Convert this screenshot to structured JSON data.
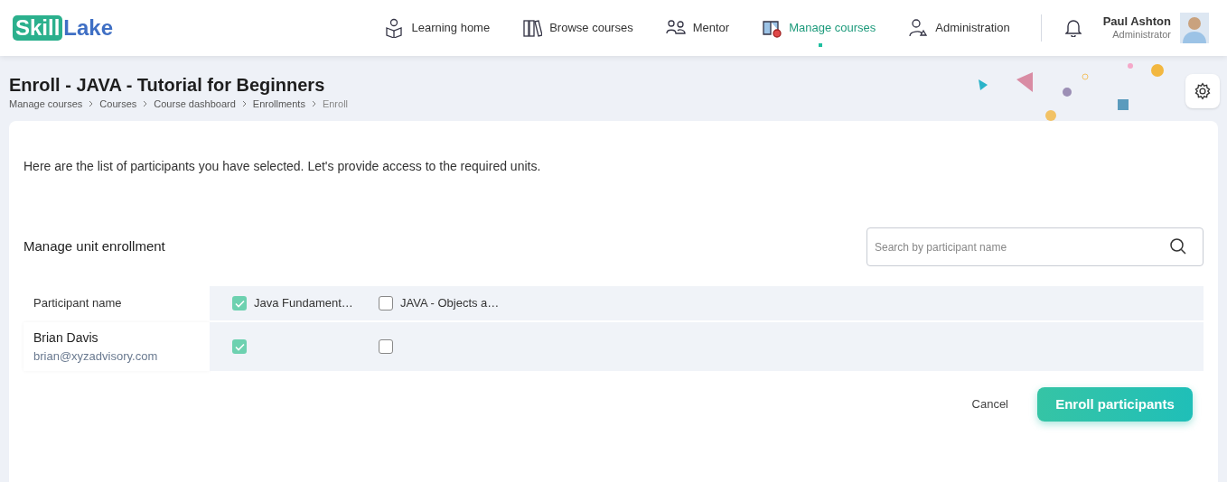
{
  "logo": {
    "part_1": "Skill",
    "part_2": "Lake"
  },
  "nav": [
    {
      "label": "Learning home",
      "selected": false
    },
    {
      "label": "Browse courses",
      "selected": false
    },
    {
      "label": "Mentor",
      "selected": false
    },
    {
      "label": "Manage courses",
      "selected": true
    },
    {
      "label": "Administration",
      "selected": false
    }
  ],
  "user": {
    "name": "Paul Ashton",
    "role": "Administrator"
  },
  "page": {
    "title": "Enroll - JAVA - Tutorial for Beginners",
    "breadcrumbs": [
      "Manage courses",
      "Courses",
      "Course dashboard",
      "Enrollments",
      "Enroll"
    ]
  },
  "intro": "Here are the list of participants you have selected. Let's provide access to the required units.",
  "section_title": "Manage unit enrollment",
  "search": {
    "placeholder": "Search by participant name"
  },
  "table": {
    "name_column": "Participant name",
    "units": [
      {
        "label": "Java Fundament…",
        "checked": true
      },
      {
        "label": "JAVA - Objects a…",
        "checked": false
      }
    ],
    "rows": [
      {
        "name": "Brian Davis",
        "email": "brian@xyzadvisory.com",
        "units": [
          {
            "checked": true
          },
          {
            "checked": false
          }
        ]
      }
    ]
  },
  "buttons": {
    "cancel": "Cancel",
    "submit": "Enroll participants"
  }
}
